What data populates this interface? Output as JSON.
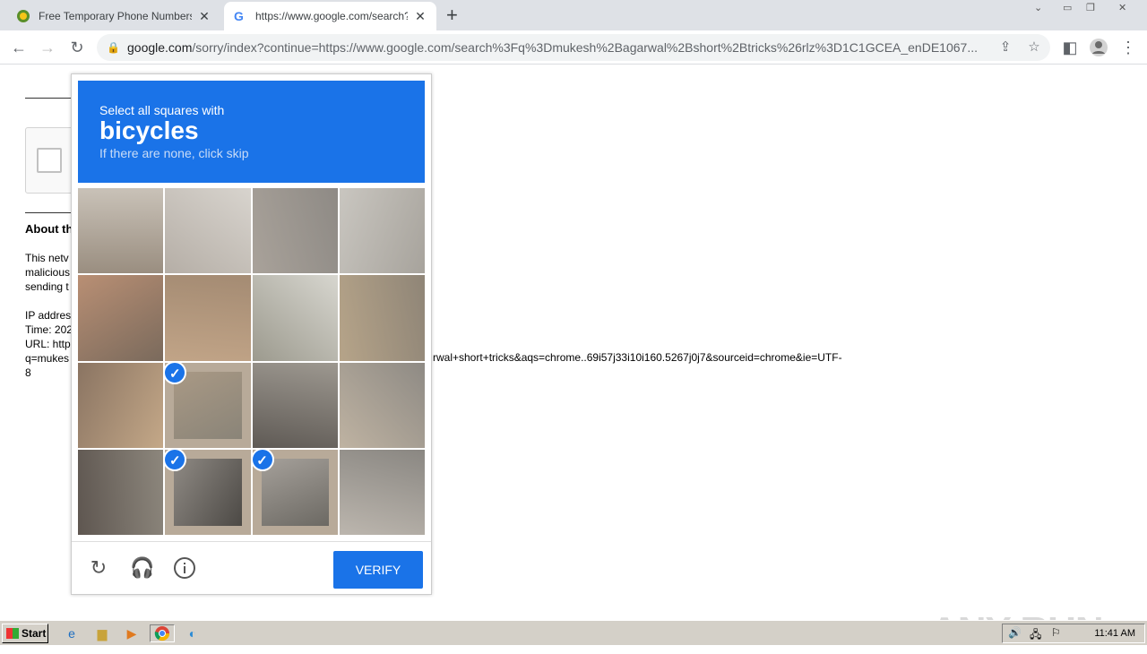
{
  "browser": {
    "tabs": [
      {
        "title": "Free Temporary Phone Numbers for",
        "active": false
      },
      {
        "title": "https://www.google.com/search?q=",
        "active": true
      }
    ],
    "url_host": "google.com",
    "url_rest": "/sorry/index?continue=https://www.google.com/search%3Fq%3Dmukesh%2Bagarwal%2Bshort%2Btricks%26rlz%3D1C1GCEA_enDE1067..."
  },
  "page": {
    "about_heading": "About th",
    "para_lines": [
      "This netv",
      "malicious",
      "sending t"
    ],
    "ip_line": "IP addres",
    "time_line": "Time: 202",
    "url_line": "URL: http",
    "q_line": "q=mukes",
    "url_tail": "rwal+short+tricks&aqs=chrome..69i57j33i10i160.5267j0j7&sourceid=chrome&ie=UTF-",
    "url_tail2": "8"
  },
  "challenge": {
    "instruction": "Select all squares with",
    "target": "bicycles",
    "hint": "If there are none, click skip",
    "verify_label": "VERIFY",
    "selected_tiles": [
      9,
      13,
      14
    ]
  },
  "taskbar": {
    "start_label": "Start",
    "clock": "11:41 AM"
  },
  "watermark": "ANY RUN"
}
